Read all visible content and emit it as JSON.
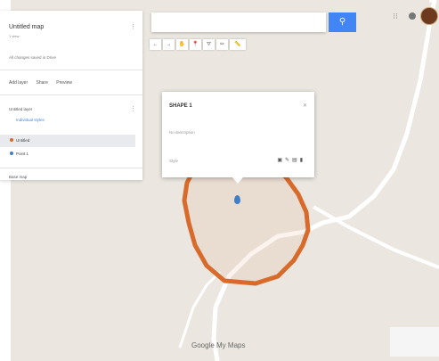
{
  "left_panel": {
    "title": "Untitled map",
    "subtitle": "1 view",
    "link": "All changes saved in Drive",
    "actions": [
      "Add layer",
      "Share",
      "Preview"
    ],
    "layer": "Untitled layer",
    "items": [
      "Individual styles",
      "Untitled",
      "Point 1"
    ],
    "base_map": "Base map"
  },
  "toolbar": {
    "buttons": [
      "←",
      "→",
      "✋",
      "📍",
      "⛛",
      "✏",
      "📏"
    ]
  },
  "card": {
    "title": "SHAPE 1",
    "description": "No description",
    "style": "Style",
    "icons": [
      "camera",
      "edit",
      "fill",
      "delete"
    ]
  },
  "footer": {
    "logo": "Google My Maps"
  },
  "colors": {
    "map_bg": "#ebe7e0",
    "boundary": "#d86b2b",
    "search": "#4285f4",
    "pin": "#3f7fc7"
  }
}
